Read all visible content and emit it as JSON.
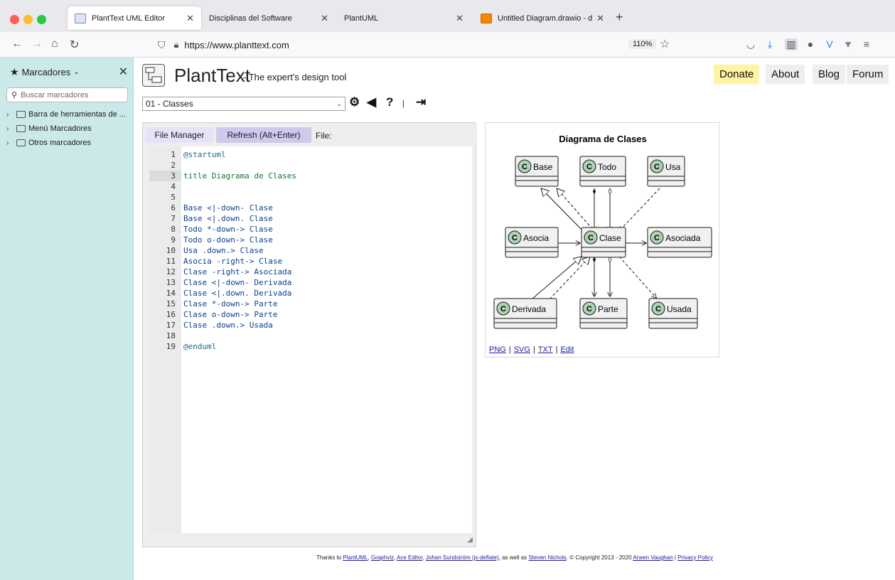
{
  "browser": {
    "tabs": [
      {
        "title": "PlantText UML Editor",
        "active": true
      },
      {
        "title": "Disciplinas del Software",
        "active": false
      },
      {
        "title": "PlantUML",
        "active": false
      },
      {
        "title": "Untitled Diagram.drawio - diagr",
        "active": false
      }
    ],
    "new_tab": "+",
    "url": "https://www.planttext.com",
    "zoom": "110%",
    "traffic_colors": [
      "#fe5f57",
      "#febc2e",
      "#28c840"
    ]
  },
  "sidebar": {
    "title": "Marcadores",
    "search_placeholder": "Buscar marcadores",
    "items": [
      {
        "label": "Barra de herramientas de ..."
      },
      {
        "label": "Menú Marcadores"
      },
      {
        "label": "Otros marcadores"
      }
    ]
  },
  "site": {
    "brand": "PlantText",
    "tagline": "- The expert's design tool",
    "nav": [
      {
        "label": "Donate"
      },
      {
        "label": "About"
      },
      {
        "label": "Blog"
      },
      {
        "label": "Forum"
      }
    ],
    "sample_selected": "01 - Classes",
    "toolbar_icons": [
      "gear-icon",
      "megaphone-icon",
      "help-icon",
      "separator",
      "exit-icon"
    ],
    "help_label": "?"
  },
  "editor": {
    "file_manager_label": "File Manager",
    "refresh_label": "Refresh (Alt+Enter)",
    "file_label": "File:",
    "active_line": 3,
    "lines": [
      "@startuml",
      "",
      "title Diagrama de Clases",
      "",
      "",
      "Base <|-down- Clase",
      "Base <|.down. Clase",
      "Todo *-down-> Clase",
      "Todo o-down-> Clase",
      "Usa .down.> Clase",
      "Asocia -right-> Clase",
      "Clase -right-> Asociada",
      "Clase <|-down- Derivada",
      "Clase <|.down. Derivada",
      "Clase *-down-> Parte",
      "Clase o-down-> Parte",
      "Clase .down.> Usada",
      "",
      "@enduml"
    ]
  },
  "diagram": {
    "title": "Diagrama de Clases",
    "classes": [
      "Base",
      "Todo",
      "Usa",
      "Asocia",
      "Clase",
      "Asociada",
      "Derivada",
      "Parte",
      "Usada"
    ],
    "class_badge": "C",
    "links": [
      "PNG",
      "SVG",
      "TXT",
      "Edit"
    ],
    "colors": {
      "class_fill": "#f1f1f1",
      "badge_fill": "#add1b2",
      "border": "#181818"
    }
  },
  "footer": {
    "thanks": "Thanks to",
    "plantuml": "PlantUML",
    "graphviz": "Graphviz",
    "ace": "Ace Editor",
    "johan": "Johan Sundström (js-deflate)",
    "as_well": ", as well as",
    "steven": "Steven Nichols",
    "copyright": ". © Copyright 2013 - 2020",
    "arwen": "Arwen Vaughan",
    "privacy": "Privacy Policy"
  }
}
